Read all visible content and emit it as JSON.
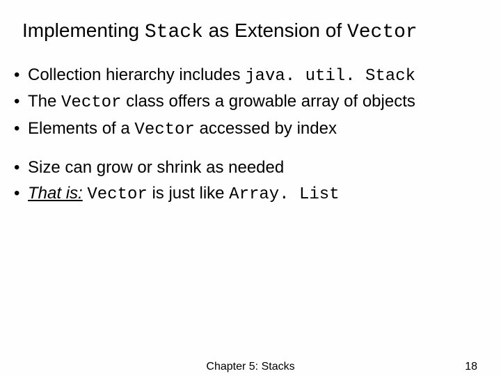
{
  "title": {
    "pre": "Implementing ",
    "code1": "Stack",
    "mid": " as Extension of ",
    "code2": "Vector"
  },
  "bullets": [
    {
      "pre": "Collection hierarchy includes ",
      "code1": "java. util. Stack",
      "post": ""
    },
    {
      "pre": "The ",
      "code1": "Vector",
      "post": " class offers a growable array of objects"
    },
    {
      "pre": "Elements of a ",
      "code1": "Vector",
      "post": " accessed by index"
    },
    {
      "pre": "Size can grow or shrink as needed",
      "code1": "",
      "post": ""
    },
    {
      "lead": "That is:",
      "pre": " ",
      "code1": "Vector",
      "mid": " is just like ",
      "code2": "Array. List"
    }
  ],
  "dot": "•",
  "footer": {
    "chapter": "Chapter 5: Stacks",
    "page": "18"
  }
}
